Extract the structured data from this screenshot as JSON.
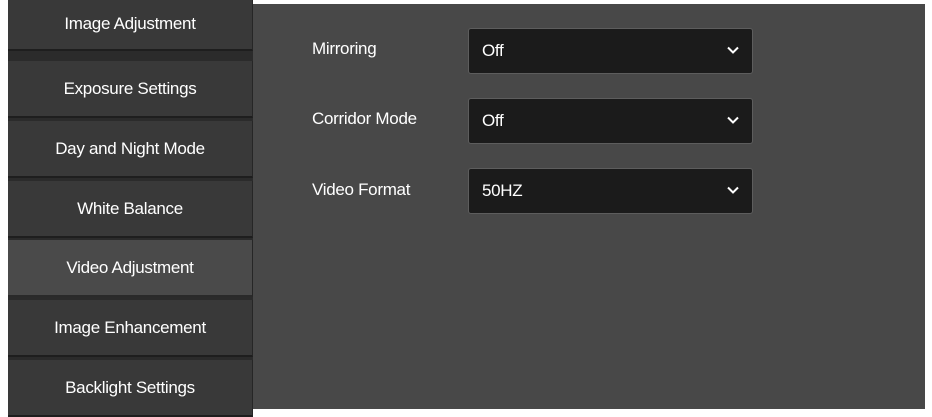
{
  "sidebar": {
    "items": [
      {
        "label": "Image Adjustment",
        "active": false
      },
      {
        "label": "Exposure Settings",
        "active": false
      },
      {
        "label": "Day and Night Mode",
        "active": false
      },
      {
        "label": "White Balance",
        "active": false
      },
      {
        "label": "Video Adjustment",
        "active": true
      },
      {
        "label": "Image Enhancement",
        "active": false
      },
      {
        "label": "Backlight Settings",
        "active": false
      }
    ]
  },
  "settings": {
    "mirroring": {
      "label": "Mirroring",
      "value": "Off"
    },
    "corridor_mode": {
      "label": "Corridor Mode",
      "value": "Off"
    },
    "video_format": {
      "label": "Video Format",
      "value": "50HZ"
    }
  },
  "icons": {
    "dropdown": "chevron-down-icon"
  },
  "colors": {
    "sidebar_bg": "#393939",
    "sidebar_active_bg": "#4a4a4a",
    "content_bg": "#484848",
    "select_bg": "#1b1b1b",
    "text": "#ffffff"
  }
}
